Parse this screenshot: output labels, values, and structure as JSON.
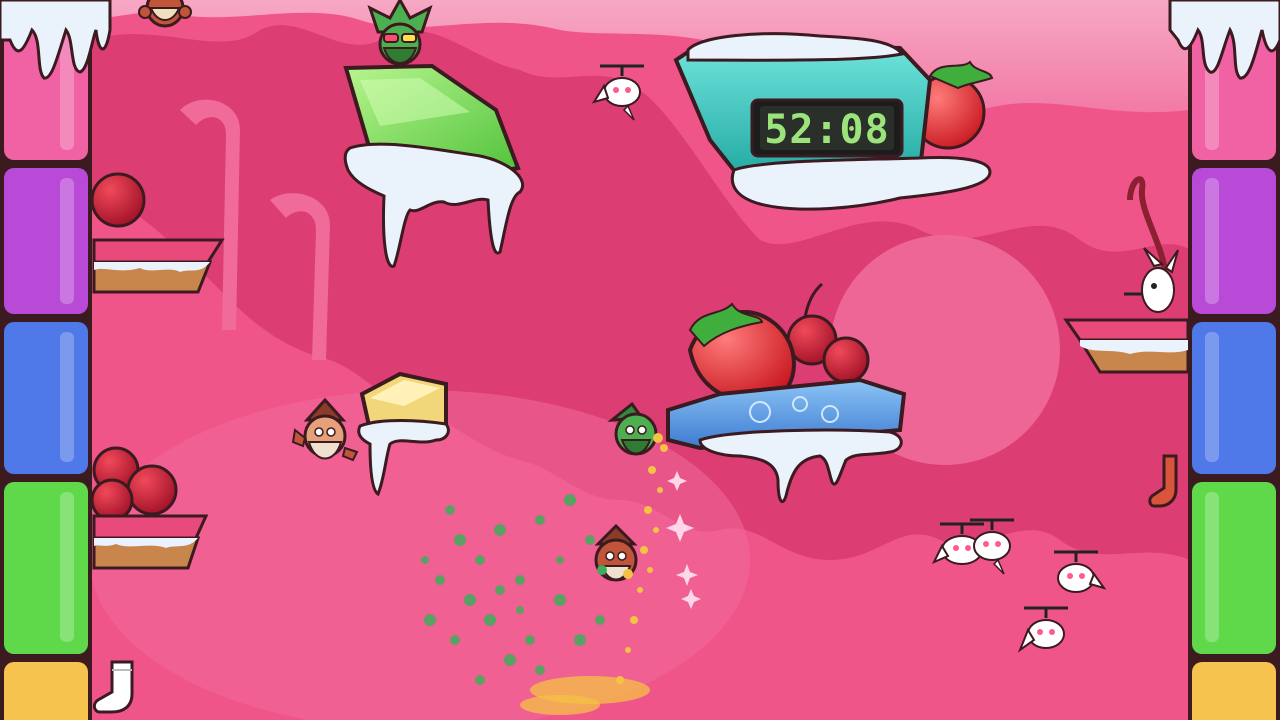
{
  "hud": {
    "timer": "52:08"
  },
  "colors": {
    "background": "#f0558a",
    "background_shadow": "#d83a6e",
    "sky_pink": "#f59ab8",
    "pillar_pink": "#f062a4",
    "pillar_purple": "#b94ad8",
    "pillar_blue": "#4f79e8",
    "pillar_green": "#5fd84a",
    "pillar_yellow": "#f6c44e",
    "jelly_green": "#7fe05a",
    "clock_teal": "#35c9c0",
    "blue_platform": "#4d8fdf",
    "cheese": "#f1d67a",
    "frosting": "#eaf2fb",
    "timer_digits": "#9be37a"
  },
  "characters": [
    {
      "id": "gnome-green-top",
      "name": "green-gnome-with-glasses-icon"
    },
    {
      "id": "gnome-red-top-left",
      "name": "red-gnome-icon"
    },
    {
      "id": "gnome-red-left",
      "name": "red-gnome-icon"
    },
    {
      "id": "gnome-green-center",
      "name": "green-gnome-icon"
    },
    {
      "id": "gnome-red-center",
      "name": "red-gnome-icon"
    }
  ],
  "enemies": [
    {
      "name": "flying-rabbit-icon"
    },
    {
      "name": "flying-rabbit-icon"
    },
    {
      "name": "flying-rabbit-icon"
    },
    {
      "name": "flying-rabbit-icon"
    },
    {
      "name": "flying-rabbit-icon"
    },
    {
      "name": "flying-rabbit-icon"
    }
  ],
  "collectibles": [
    {
      "name": "white-sock-icon"
    },
    {
      "name": "red-sock-icon"
    }
  ]
}
